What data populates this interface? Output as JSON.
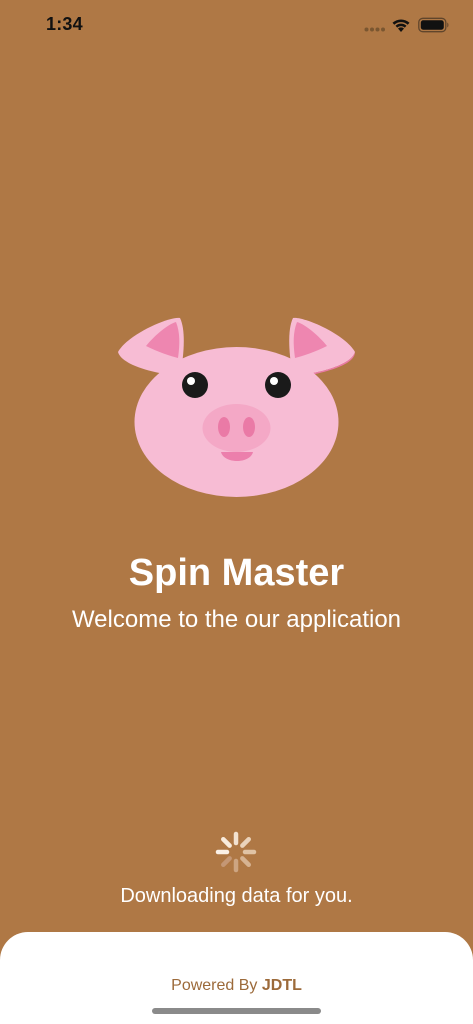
{
  "status_bar": {
    "time": "1:34",
    "icons": [
      "signal-dots-icon",
      "wifi-icon",
      "battery-icon"
    ]
  },
  "splash": {
    "logo": "pig-face-icon",
    "title": "Spin Master",
    "subtitle": "Welcome to the our application",
    "loading_text": "Downloading data for you."
  },
  "footer": {
    "powered_prefix": "Powered By ",
    "brand": "JDTL"
  },
  "colors": {
    "background": "#AF7845",
    "pig_pink": "#F7BCD4",
    "pig_dark_pink": "#EE7FAA",
    "footer_text": "#9C6A3A"
  }
}
